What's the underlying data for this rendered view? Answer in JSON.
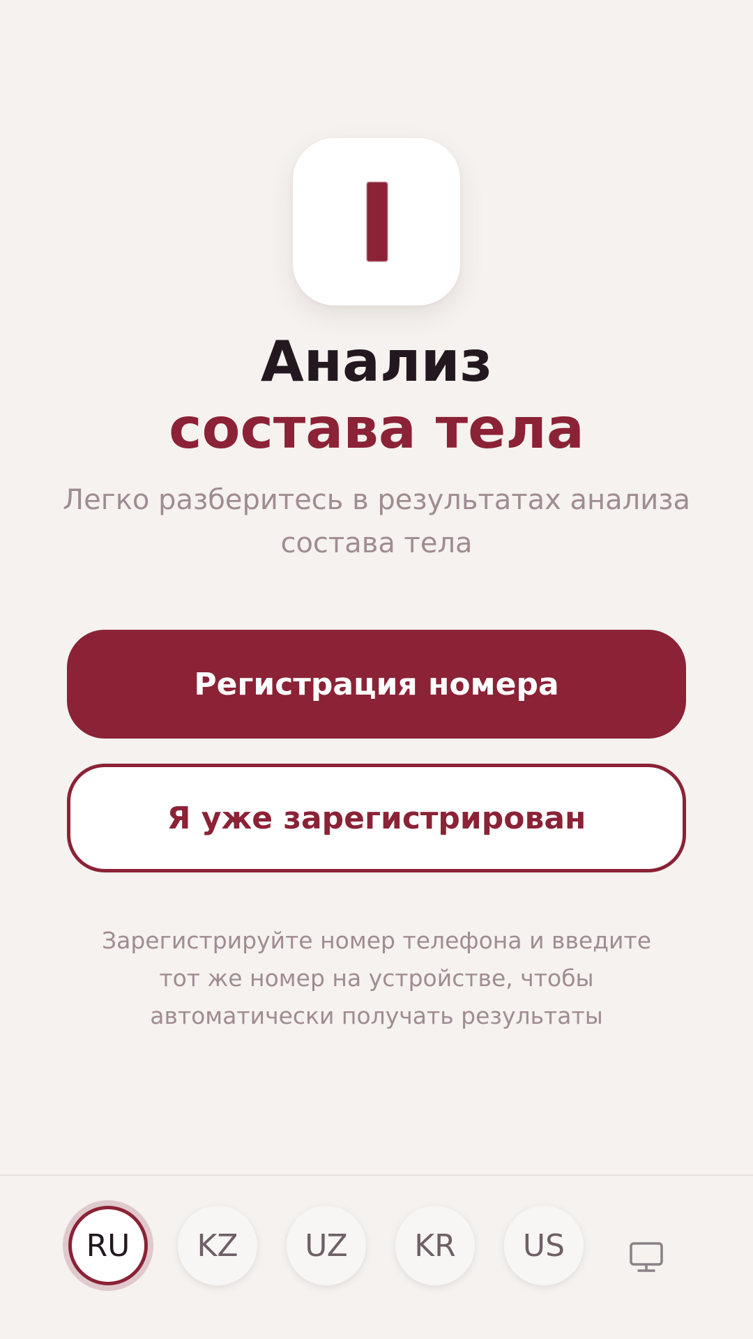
{
  "app": {
    "logo_letter": "I",
    "title_line1": "Анализ",
    "title_line2": "состава тела",
    "subtitle": "Легко разберитесь в результатах анализа состава тела"
  },
  "actions": {
    "register_label": "Регистрация номера",
    "login_label": "Я уже зарегистрирован"
  },
  "hint": "Зарегистрируйте номер телефона и введите тот же номер на устройстве, чтобы автоматически получать результаты",
  "languages": [
    {
      "code": "RU",
      "selected": true
    },
    {
      "code": "KZ",
      "selected": false
    },
    {
      "code": "UZ",
      "selected": false
    },
    {
      "code": "KR",
      "selected": false
    },
    {
      "code": "US",
      "selected": false
    }
  ],
  "footer_icon": "monitor-icon",
  "colors": {
    "accent": "#8b2236",
    "background": "#f5f2ef",
    "title_dark": "#231820",
    "muted_text": "#a08c92"
  }
}
